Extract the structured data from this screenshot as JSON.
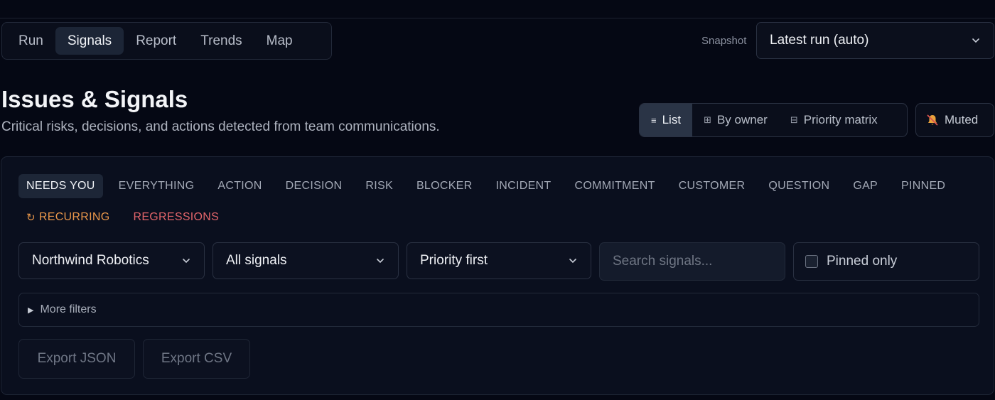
{
  "nav": {
    "tabs": [
      {
        "label": "Run"
      },
      {
        "label": "Signals"
      },
      {
        "label": "Report"
      },
      {
        "label": "Trends"
      },
      {
        "label": "Map"
      }
    ],
    "active_tab": "Signals"
  },
  "snapshot": {
    "label": "Snapshot",
    "value": "Latest run (auto)"
  },
  "header": {
    "title": "Issues & Signals",
    "subtitle": "Critical risks, decisions, and actions detected from team communications."
  },
  "views": {
    "list": "List",
    "by_owner": "By owner",
    "priority_matrix": "Priority matrix",
    "muted": "Muted",
    "active_view": "List"
  },
  "filters": {
    "row1": [
      "NEEDS YOU",
      "EVERYTHING",
      "ACTION",
      "DECISION",
      "RISK",
      "BLOCKER",
      "INCIDENT",
      "COMMITMENT",
      "CUSTOMER",
      "QUESTION",
      "GAP",
      "PINNED"
    ],
    "recurring": "RECURRING",
    "regressions": "REGRESSIONS",
    "active_filter": "NEEDS YOU"
  },
  "controls": {
    "org": "Northwind Robotics",
    "signal_type": "All signals",
    "sort": "Priority first",
    "search_placeholder": "Search signals...",
    "search_value": "",
    "pinned_only": "Pinned only",
    "pinned_checked": false
  },
  "more_filters": "More filters",
  "export": {
    "json": "Export JSON",
    "csv": "Export CSV"
  },
  "colors": {
    "background": "#050814",
    "panel": "#0a0f1e",
    "recurring": "#e8964a",
    "regressions": "#e2656a"
  }
}
